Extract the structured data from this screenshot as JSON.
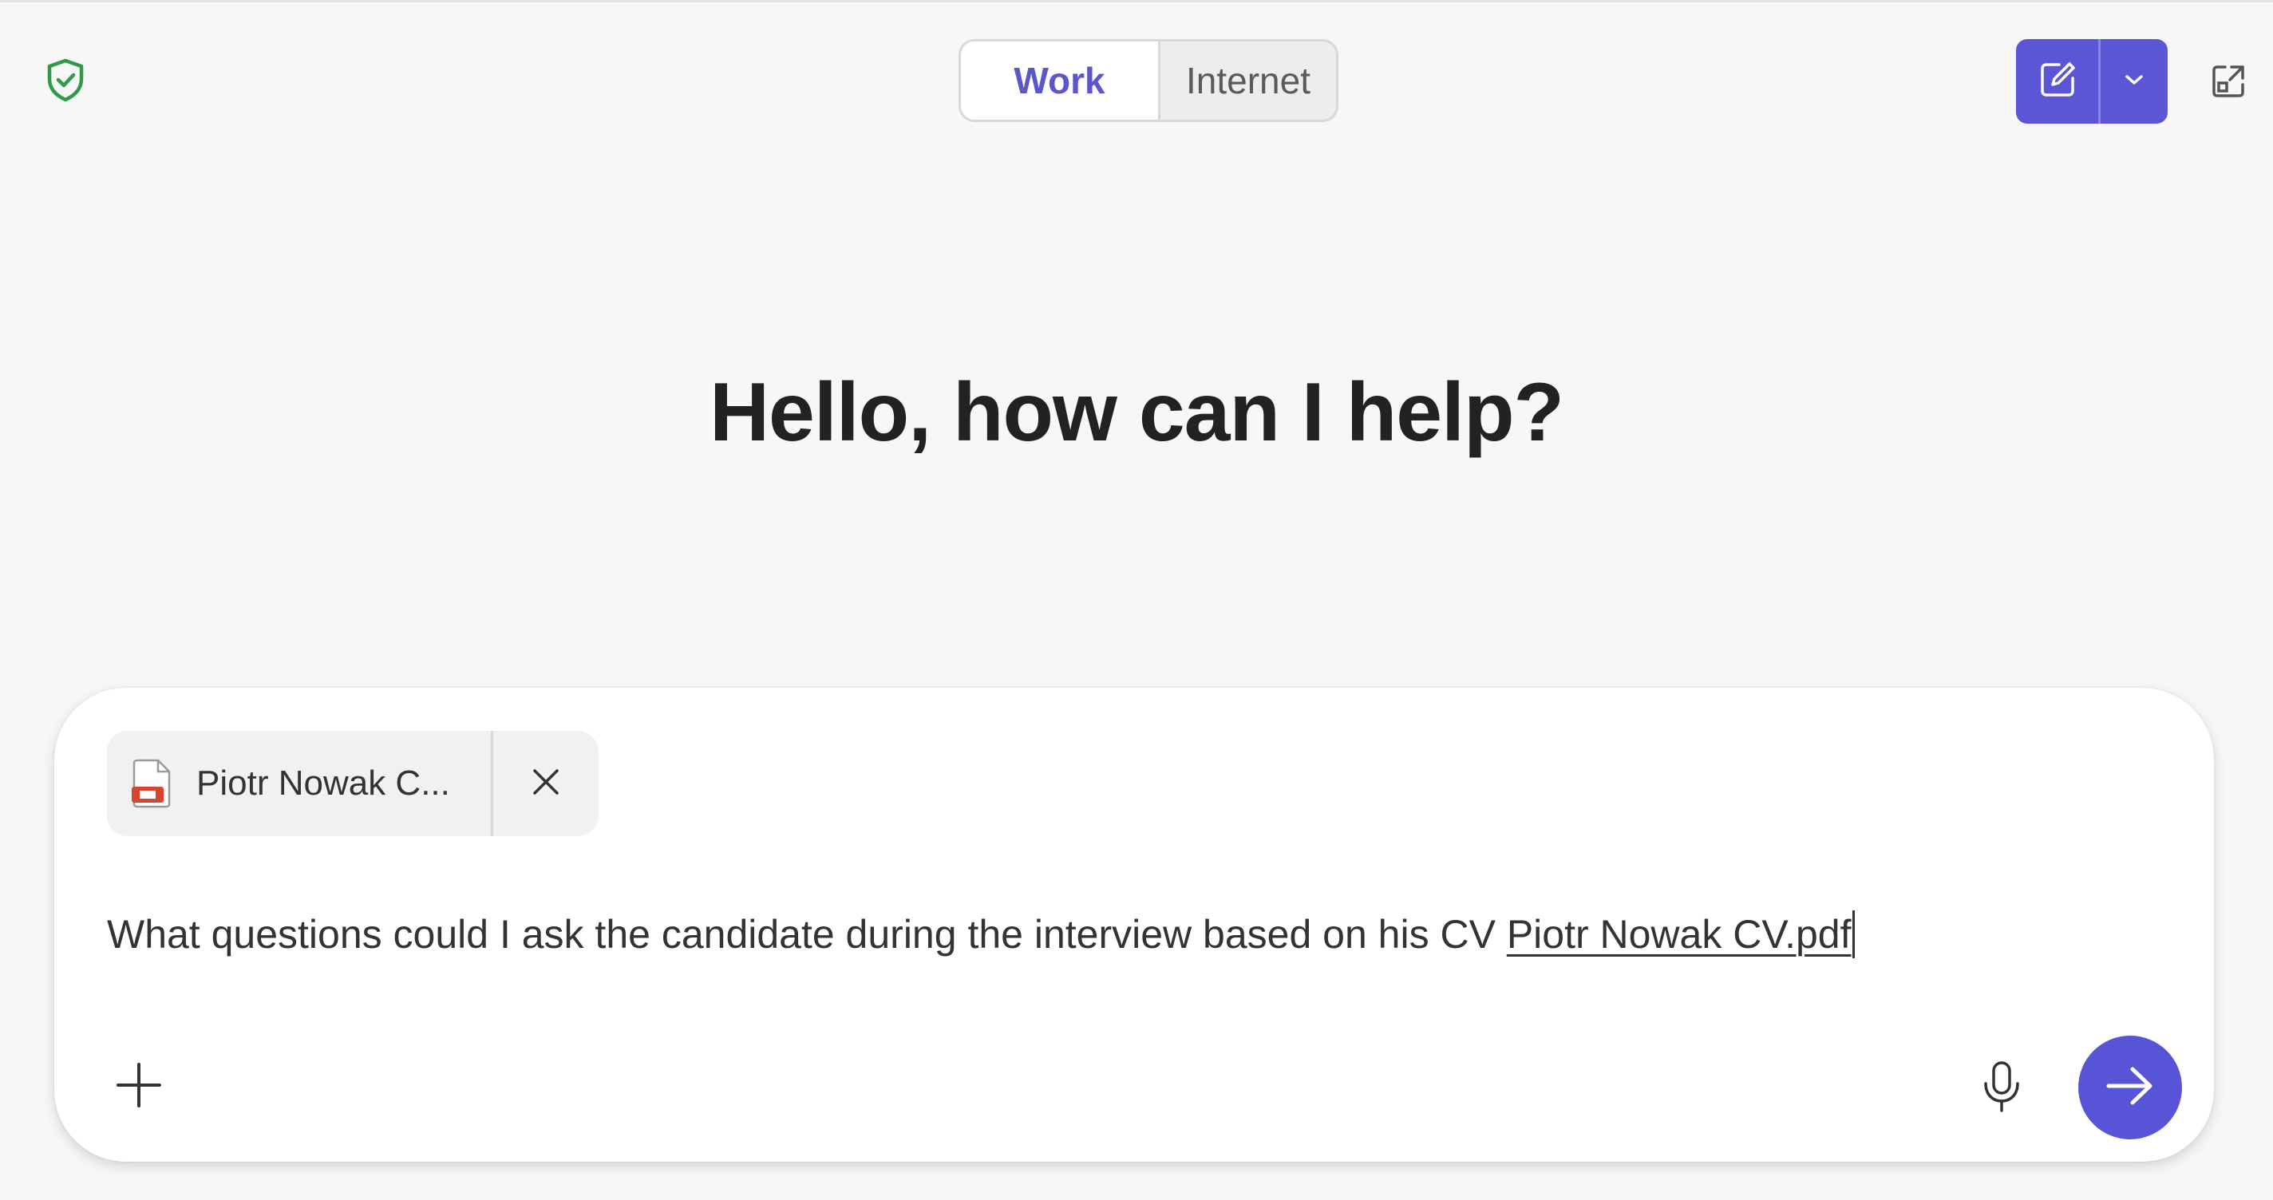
{
  "header": {
    "shield_icon": "shield-check-icon",
    "mode_tabs": [
      {
        "label": "Work",
        "selected": true
      },
      {
        "label": "Internet",
        "selected": false
      }
    ],
    "new_chat_icon": "compose-icon",
    "dropdown_icon": "chevron-down-icon",
    "expand_icon": "open-external-icon"
  },
  "main": {
    "greeting": "Hello, how can I help?"
  },
  "composer": {
    "attachment": {
      "name": "Piotr Nowak C...",
      "icon": "pdf-file-icon"
    },
    "prompt_text": "What questions could I ask the candidate during the interview based on his CV ",
    "prompt_file_ref": "Piotr Nowak CV.pdf",
    "add_icon": "plus-icon",
    "mic_icon": "microphone-icon",
    "send_icon": "arrow-right-icon"
  },
  "colors": {
    "accent": "#5b56d6",
    "shield": "#2e9b49",
    "background": "#f7f7f7"
  }
}
